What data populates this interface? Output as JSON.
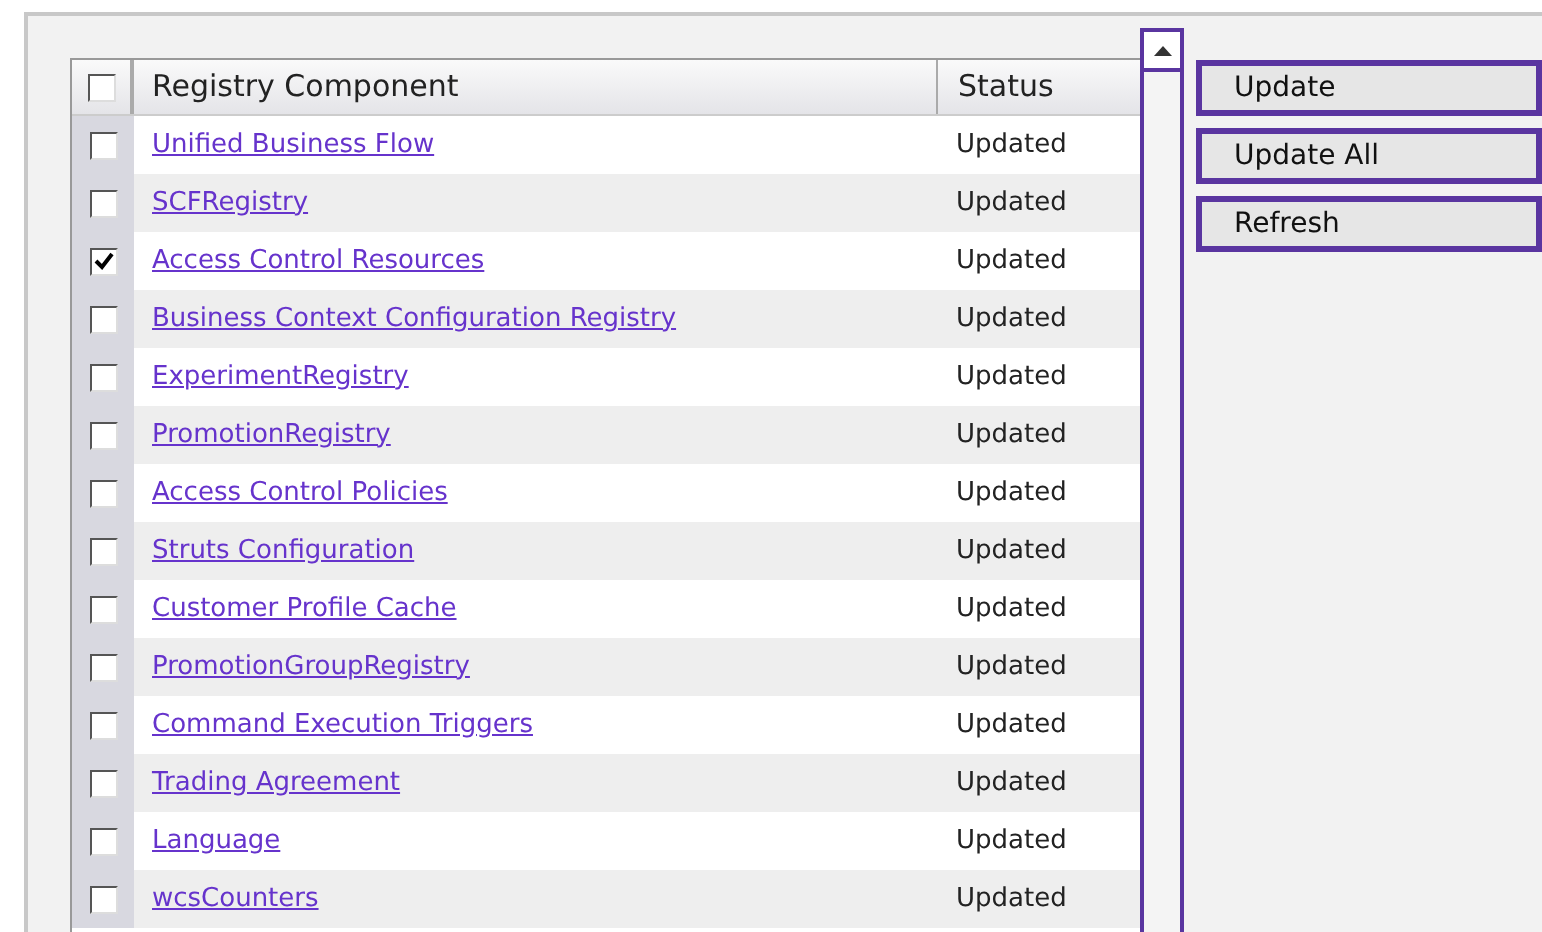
{
  "table": {
    "select_all": {
      "checked": false
    },
    "columns": [
      "Registry Component",
      "Status"
    ],
    "rows": [
      {
        "checked": false,
        "name": "Unified Business Flow",
        "status": "Updated"
      },
      {
        "checked": false,
        "name": "SCFRegistry",
        "status": "Updated"
      },
      {
        "checked": true,
        "name": "Access Control Resources",
        "status": "Updated"
      },
      {
        "checked": false,
        "name": "Business Context Configuration Registry",
        "status": "Updated"
      },
      {
        "checked": false,
        "name": "ExperimentRegistry",
        "status": "Updated"
      },
      {
        "checked": false,
        "name": "PromotionRegistry",
        "status": "Updated"
      },
      {
        "checked": false,
        "name": "Access Control Policies",
        "status": "Updated"
      },
      {
        "checked": false,
        "name": "Struts Configuration",
        "status": "Updated"
      },
      {
        "checked": false,
        "name": "Customer Profile Cache",
        "status": "Updated"
      },
      {
        "checked": false,
        "name": "PromotionGroupRegistry",
        "status": "Updated"
      },
      {
        "checked": false,
        "name": "Command Execution Triggers",
        "status": "Updated"
      },
      {
        "checked": false,
        "name": "Trading Agreement",
        "status": "Updated"
      },
      {
        "checked": false,
        "name": "Language",
        "status": "Updated"
      },
      {
        "checked": false,
        "name": "wcsCounters",
        "status": "Updated"
      }
    ]
  },
  "buttons": [
    "Update",
    "Update All",
    "Refresh"
  ]
}
